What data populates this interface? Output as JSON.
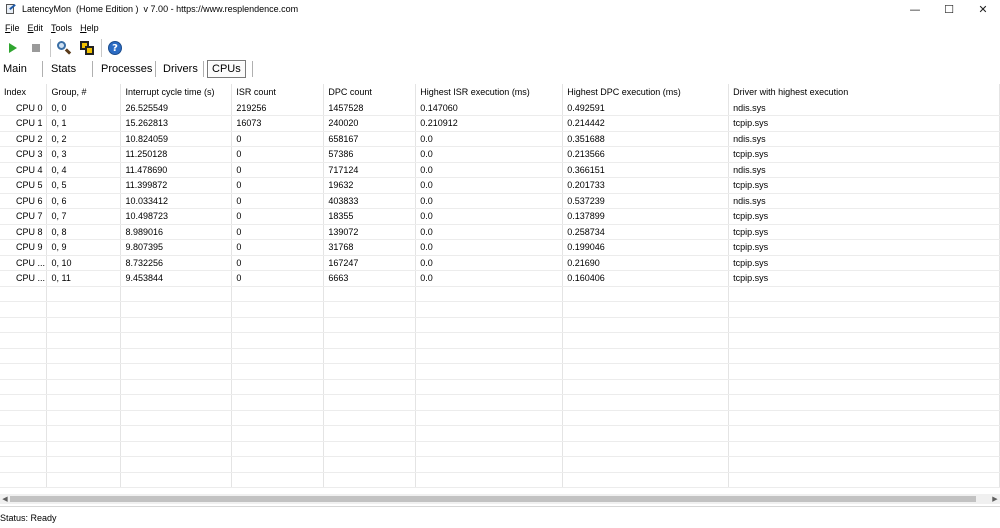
{
  "window": {
    "title": "LatencyMon  (Home Edition )  v 7.00 - https://www.resplendence.com",
    "minimize": "—",
    "maximize": "☐",
    "close": "✕"
  },
  "menu": [
    {
      "first": "F",
      "rest": "ile"
    },
    {
      "first": "E",
      "rest": "dit"
    },
    {
      "first": "T",
      "rest": "ools"
    },
    {
      "first": "H",
      "rest": "elp"
    }
  ],
  "toolbar": {
    "icons": [
      "play-icon",
      "stop-icon",
      "magnifier-icon",
      "windows-icon",
      "help-icon"
    ],
    "help_glyph": "?"
  },
  "tabs": {
    "main": "Main",
    "stats": "Stats",
    "processes": "Processes",
    "drivers": "Drivers",
    "cpus": "CPUs"
  },
  "table": {
    "headers": [
      "Index",
      "Group, #",
      "Interrupt cycle time (s)",
      "ISR count",
      "DPC count",
      "Highest ISR execution (ms)",
      "Highest DPC execution (ms)",
      "Driver with highest execution"
    ],
    "rows": [
      [
        "CPU 0",
        "0, 0",
        "26.525549",
        "219256",
        "1457528",
        "0.147060",
        "0.492591",
        "ndis.sys"
      ],
      [
        "CPU 1",
        "0, 1",
        "15.262813",
        "16073",
        "240020",
        "0.210912",
        "0.214442",
        "tcpip.sys"
      ],
      [
        "CPU 2",
        "0, 2",
        "10.824059",
        "0",
        "658167",
        "0.0",
        "0.351688",
        "ndis.sys"
      ],
      [
        "CPU 3",
        "0, 3",
        "11.250128",
        "0",
        "57386",
        "0.0",
        "0.213566",
        "tcpip.sys"
      ],
      [
        "CPU 4",
        "0, 4",
        "11.478690",
        "0",
        "717124",
        "0.0",
        "0.366151",
        "ndis.sys"
      ],
      [
        "CPU 5",
        "0, 5",
        "11.399872",
        "0",
        "19632",
        "0.0",
        "0.201733",
        "tcpip.sys"
      ],
      [
        "CPU 6",
        "0, 6",
        "10.033412",
        "0",
        "403833",
        "0.0",
        "0.537239",
        "ndis.sys"
      ],
      [
        "CPU 7",
        "0, 7",
        "10.498723",
        "0",
        "18355",
        "0.0",
        "0.137899",
        "tcpip.sys"
      ],
      [
        "CPU 8",
        "0, 8",
        "8.989016",
        "0",
        "139072",
        "0.0",
        "0.258734",
        "tcpip.sys"
      ],
      [
        "CPU 9",
        "0, 9",
        "9.807395",
        "0",
        "31768",
        "0.0",
        "0.199046",
        "tcpip.sys"
      ],
      [
        "CPU ...",
        "0, 10",
        "8.732256",
        "0",
        "167247",
        "0.0",
        "0.21690",
        "tcpip.sys"
      ],
      [
        "CPU ...",
        "0, 11",
        "9.453844",
        "0",
        "6663",
        "0.0",
        "0.160406",
        "tcpip.sys"
      ]
    ]
  },
  "scrollbar": {
    "left": "◀",
    "right": "▶"
  },
  "status": {
    "text": "Status: Ready"
  }
}
